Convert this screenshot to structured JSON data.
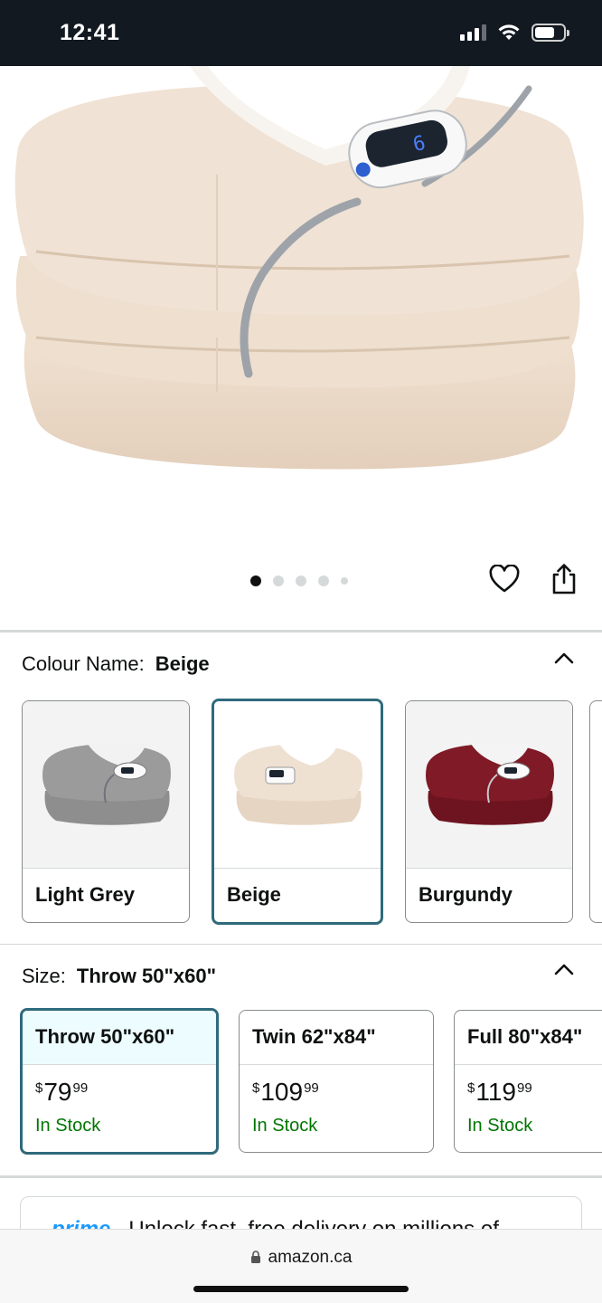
{
  "status_bar": {
    "time": "12:41"
  },
  "hero": {
    "image_alt": "electric-blanket-beige",
    "carousel_total": 5,
    "carousel_active": 1
  },
  "colour": {
    "label": "Colour Name:",
    "selected": "Beige",
    "options": [
      {
        "name": "Light Grey",
        "swatch_color": "#8e8e8e"
      },
      {
        "name": "Beige",
        "swatch_color": "#ecdccb"
      },
      {
        "name": "Burgundy",
        "swatch_color": "#7a1622"
      }
    ]
  },
  "size": {
    "label": "Size:",
    "selected": "Throw 50\"x60\"",
    "options": [
      {
        "name": "Throw 50\"x60\"",
        "currency": "$",
        "whole": "79",
        "cents": "99",
        "stock": "In Stock"
      },
      {
        "name": "Twin 62\"x84\"",
        "currency": "$",
        "whole": "109",
        "cents": "99",
        "stock": "In Stock"
      },
      {
        "name": "Full 80\"x84\"",
        "currency": "$",
        "whole": "119",
        "cents": "99",
        "stock": "In Stock"
      }
    ]
  },
  "prime": {
    "logo": "prime",
    "text": "Unlock fast, free delivery on millions of"
  },
  "browser": {
    "url": "amazon.ca"
  },
  "colors": {
    "selected_border": "#2e6a7b",
    "in_stock": "#007600",
    "header_bg": "#131921"
  }
}
